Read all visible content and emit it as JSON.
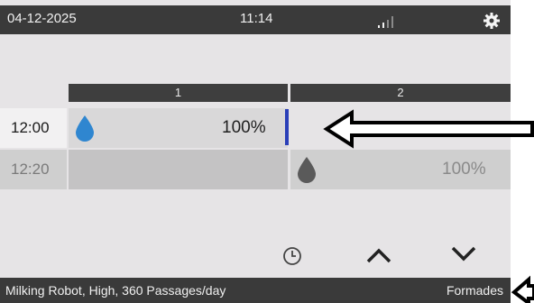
{
  "status_bar": {
    "date": "04-12-2025",
    "time": "11:14"
  },
  "columns": [
    "1",
    "2"
  ],
  "rows": [
    {
      "time": "12:00",
      "slot1_percent": "100%",
      "slot2_percent": ""
    },
    {
      "time": "12:20",
      "slot1_percent": "",
      "slot2_percent": "100%"
    }
  ],
  "footer": {
    "info": "Milking Robot, High, 360 Passages/day",
    "language": "Formades"
  },
  "icons": {
    "signal": "signal-strength-icon",
    "settings": "gear-icon",
    "drop": "water-drop-icon",
    "clock": "clock-icon",
    "up": "chevron-up-icon",
    "down": "chevron-down-icon"
  },
  "colors": {
    "drop_active": "#2f86d0",
    "drop_inactive": "#5a5a5a",
    "cursor": "#2a3fb8"
  }
}
